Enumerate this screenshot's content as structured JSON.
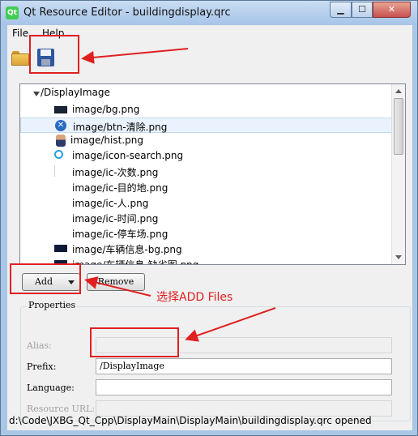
{
  "window": {
    "title": "Qt Resource Editor - buildingdisplay.qrc",
    "logo_text": "Qt",
    "controls": {
      "minimize": "▁",
      "maximize": "☐",
      "close": "✕"
    }
  },
  "menubar": {
    "items": [
      "File",
      "Help"
    ]
  },
  "toolbar": {
    "open_icon": "folder-icon",
    "save_icon": "floppy-save-icon"
  },
  "tree": {
    "root_prefix": "/DisplayImage",
    "files": [
      {
        "name": "image/bg.png",
        "icon": "dark-image-thumbnail"
      },
      {
        "name": "image/btn-清除.png",
        "icon": "x-circle-thumbnail",
        "selected": true
      },
      {
        "name": "image/hist.png",
        "icon": "person-thumbnail"
      },
      {
        "name": "image/icon-search.png",
        "icon": "search-thumbnail"
      },
      {
        "name": "image/ic-次数.png",
        "icon": "faint-thumbnail"
      },
      {
        "name": "image/ic-目的地.png",
        "icon": "blank-thumbnail"
      },
      {
        "name": "image/ic-人.png",
        "icon": "blank-thumbnail"
      },
      {
        "name": "image/ic-时间.png",
        "icon": "blank-thumbnail"
      },
      {
        "name": "image/ic-停车场.png",
        "icon": "blank-thumbnail"
      },
      {
        "name": "image/车辆信息-bg.png",
        "icon": "navy-thumbnail"
      },
      {
        "name": "image/车辆信息-缺省图.png",
        "icon": "navy-thumbnail"
      }
    ]
  },
  "buttons": {
    "add": "Add",
    "remove": "Remove"
  },
  "properties": {
    "title": "Properties",
    "alias_label": "Alias:",
    "alias_value": "",
    "prefix_label": "Prefix:",
    "prefix_value": "/DisplayImage",
    "language_label": "Language:",
    "language_value": "",
    "resource_url_label": "Resource URL:",
    "resource_url_value": ""
  },
  "statusbar": {
    "text": "d:\\Code\\JXBG_Qt_Cpp\\DisplayMain\\DisplayMain\\buildingdisplay.qrc opened"
  },
  "annotation": {
    "text": "选择ADD Files",
    "color": "#e02020"
  }
}
